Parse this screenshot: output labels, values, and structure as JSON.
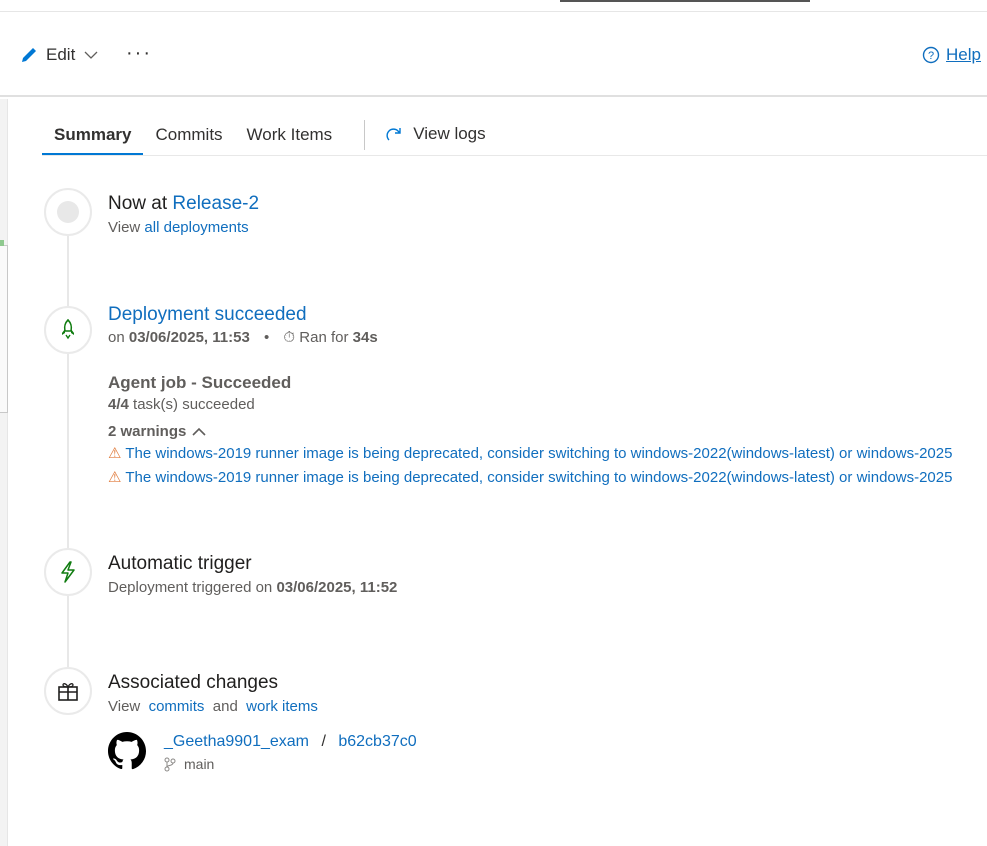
{
  "toolbar": {
    "edit_label": "Edit",
    "more_label": "···",
    "help_label": "Help"
  },
  "tabs": [
    {
      "label": "Summary",
      "active": true
    },
    {
      "label": "Commits"
    },
    {
      "label": "Work Items"
    }
  ],
  "view_logs": "View logs",
  "now_at": {
    "prefix": "Now at",
    "release": "Release-2",
    "view": "View",
    "all_deployments": "all deployments"
  },
  "deployment": {
    "title": "Deployment succeeded",
    "on": "on",
    "date": "03/06/2025, 11:53",
    "dot": "•",
    "ran_for": "Ran for",
    "duration": "34s",
    "job_title": "Agent job - Succeeded",
    "tasks_count": "4/4",
    "tasks_text": "task(s) succeeded",
    "warnings_label": "2 warnings",
    "warnings": [
      "The windows-2019 runner image is being deprecated, consider switching to windows-2022(windows-latest) or windows-2025",
      "The windows-2019 runner image is being deprecated, consider switching to windows-2022(windows-latest) or windows-2025"
    ]
  },
  "trigger": {
    "title": "Automatic trigger",
    "text": "Deployment triggered on",
    "date": "03/06/2025, 11:52"
  },
  "changes": {
    "title": "Associated changes",
    "view": "View",
    "commits": "commits",
    "and": "and",
    "work_items": "work items",
    "repo": "_Geetha9901_exam",
    "slash": "/",
    "commit": "b62cb37c0",
    "branch": "main"
  },
  "colors": {
    "accent": "#0078d4",
    "link": "#106ebe",
    "success": "#107c10",
    "warning": "#e07a3a"
  }
}
